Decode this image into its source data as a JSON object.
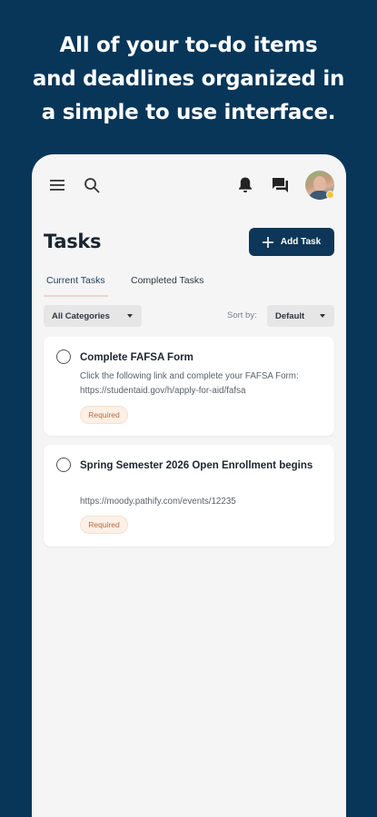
{
  "headline": {
    "line1": "All of your to-do items",
    "line2": "and deadlines organized in",
    "line3": "a simple to use interface."
  },
  "topbar": {
    "icons": [
      "menu-icon",
      "search-icon",
      "bell-icon",
      "chat-icon"
    ]
  },
  "page": {
    "title": "Tasks",
    "add_button_label": "Add Task"
  },
  "tabs": [
    {
      "label": "Current Tasks",
      "active": true
    },
    {
      "label": "Completed Tasks",
      "active": false
    }
  ],
  "filters": {
    "category_selected": "All Categories",
    "sort_label": "Sort by:",
    "sort_selected": "Default"
  },
  "tasks": [
    {
      "title": "Complete FAFSA Form",
      "description": "Click the following link and complete your FAFSA Form: https://studentaid.gov/h/apply-for-aid/fafsa",
      "badge": "Required"
    },
    {
      "title": "Spring Semester 2026 Open Enrollment begins",
      "description": "https://moody.pathify.com/events/12235",
      "badge": "Required"
    }
  ],
  "colors": {
    "background": "#073659",
    "accent": "#0d3658",
    "badge_text": "#b86a3b",
    "badge_bg": "#fdf0e6"
  }
}
